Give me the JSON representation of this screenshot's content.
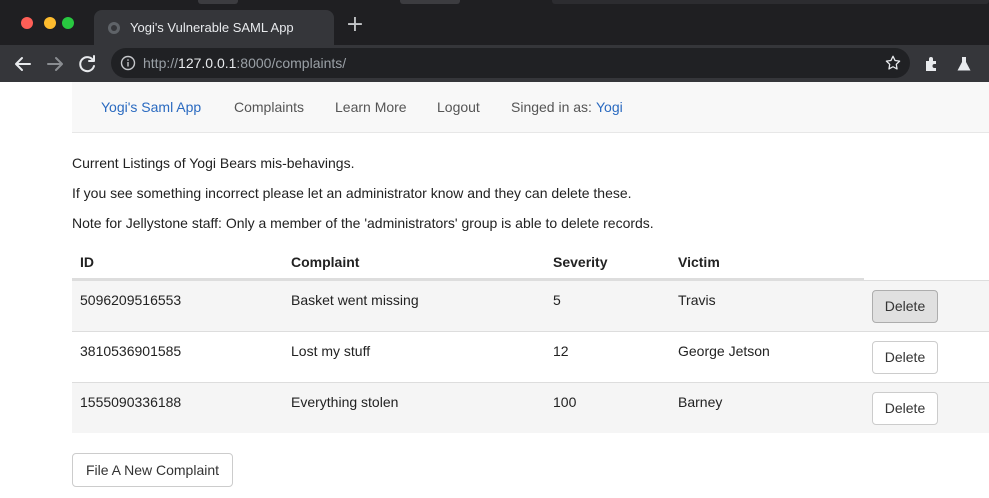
{
  "browser": {
    "tab_title": "Yogi's Vulnerable SAML App",
    "url_prefix": "http://",
    "url_host": "127.0.0.1",
    "url_rest": ":8000/complaints/",
    "icons": {
      "back": "arrow-left-icon",
      "forward": "arrow-right-icon",
      "reload": "reload-icon",
      "info": "info-icon",
      "bookmark": "star-icon",
      "extensions": "puzzle-icon",
      "labs": "flask-icon"
    }
  },
  "navbar": {
    "brand": "Yogi's Saml App",
    "complaints": "Complaints",
    "learn_more": "Learn More",
    "logout": "Logout",
    "signed_in_label": "Singed in as:",
    "signed_in_user": "Yogi"
  },
  "intro": {
    "line1": "Current Listings of Yogi Bears mis-behavings.",
    "line2": "If you see something incorrect please let an administrator know and they can delete these.",
    "line3": "Note for Jellystone staff: Only a member of the 'administrators' group is able to delete records."
  },
  "table": {
    "headers": {
      "id": "ID",
      "complaint": "Complaint",
      "severity": "Severity",
      "victim": "Victim"
    },
    "rows": [
      {
        "id": "5096209516553",
        "complaint": "Basket went missing",
        "severity": "5",
        "victim": "Travis",
        "action": "Delete"
      },
      {
        "id": "3810536901585",
        "complaint": "Lost my stuff",
        "severity": "12",
        "victim": "George Jetson",
        "action": "Delete"
      },
      {
        "id": "1555090336188",
        "complaint": "Everything stolen",
        "severity": "100",
        "victim": "Barney",
        "action": "Delete"
      }
    ]
  },
  "new_complaint_button": "File A New Complaint",
  "colors": {
    "link": "#2a6ac0",
    "navbar_bg": "#f8f8f8",
    "chrome_dark": "#35363a",
    "titlebar": "#1f1f22"
  }
}
